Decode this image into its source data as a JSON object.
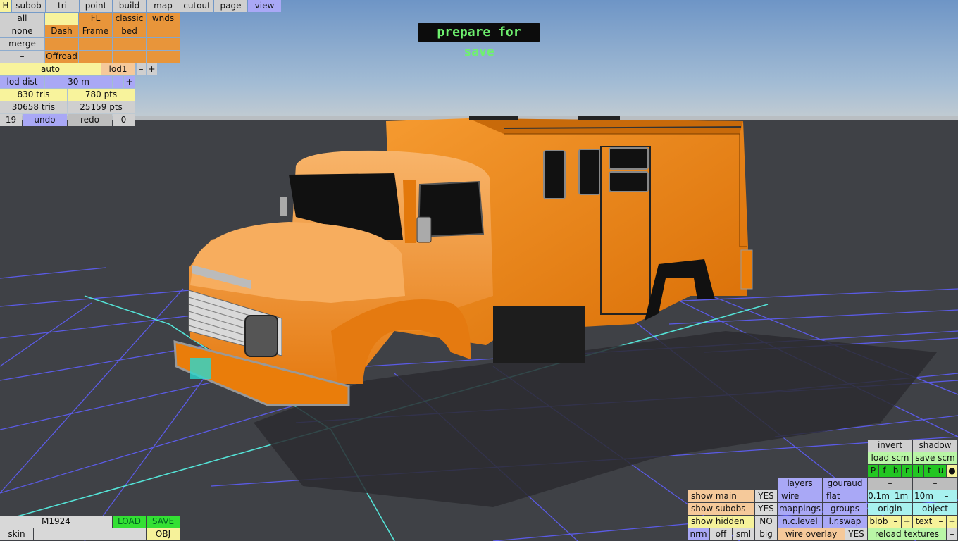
{
  "tabs": {
    "h": "H",
    "subob": "subob",
    "tri": "tri",
    "point": "point",
    "build": "build",
    "map": "map",
    "cutout": "cutout",
    "page": "page",
    "view": "view"
  },
  "filter": {
    "all": "all",
    "fl": "FL",
    "classic": "classic",
    "wnds": "wnds",
    "none": "none",
    "dash": "Dash",
    "frame": "Frame",
    "bed": "bed",
    "merge": "merge",
    "minus": "–",
    "offroad": "Offroad"
  },
  "lod": {
    "auto": "auto",
    "lod1": "lod1",
    "minus": "–",
    "plus": "+",
    "dist_label": "lod dist",
    "dist_value": "30 m"
  },
  "stats": {
    "tris_sel": "830 tris",
    "pts_sel": "780 pts",
    "tris_total": "30658 tris",
    "pts_total": "25159 pts"
  },
  "history": {
    "count": "19",
    "undo": "undo",
    "redo": "redo",
    "redo_count": "0"
  },
  "banner": "prepare for save",
  "right_panel": {
    "invert": "invert",
    "shadow": "shadow",
    "load_scm": "load scm",
    "save_scm": "save scm",
    "flags": [
      "P",
      "f",
      "b",
      "r",
      "l",
      "t",
      "u",
      "●"
    ],
    "dash1": "–",
    "dash2": "–",
    "layers": "layers",
    "gouraud": "gouraud",
    "show_main": "show main",
    "show_main_val": "YES",
    "wire": "wire",
    "flat": "flat",
    "step_01": "0.1m",
    "step_1": "1m",
    "step_10": "10m",
    "step_minus": "–",
    "show_subobs": "show subobs",
    "show_subobs_val": "YES",
    "mappings": "mappings",
    "groups": "groups",
    "origin": "origin",
    "object": "object",
    "show_hidden": "show hidden",
    "show_hidden_val": "NO",
    "nc_level": "n.c.level",
    "lr_swap": "l.r.swap",
    "blob": "blob",
    "blob_minus": "–",
    "blob_plus": "+",
    "text": "text",
    "text_minus": "–",
    "text_plus": "+",
    "nrm": "nrm",
    "off": "off",
    "sml": "sml",
    "big": "big",
    "wire_overlay": "wire overlay",
    "wire_overlay_val": "YES",
    "reload_textures": "reload textures",
    "reload_minus": "–"
  },
  "bottom_left": {
    "model": "M1924",
    "load": "LOAD",
    "save": "SAVE",
    "skin": "skin",
    "obj": "OBJ"
  },
  "colors": {
    "truck": "#ea7d0a",
    "sky_top": "#6f96c8",
    "ground": "#404247",
    "grid": "#5a5ae6",
    "grid_axis": "#53e2d6"
  }
}
